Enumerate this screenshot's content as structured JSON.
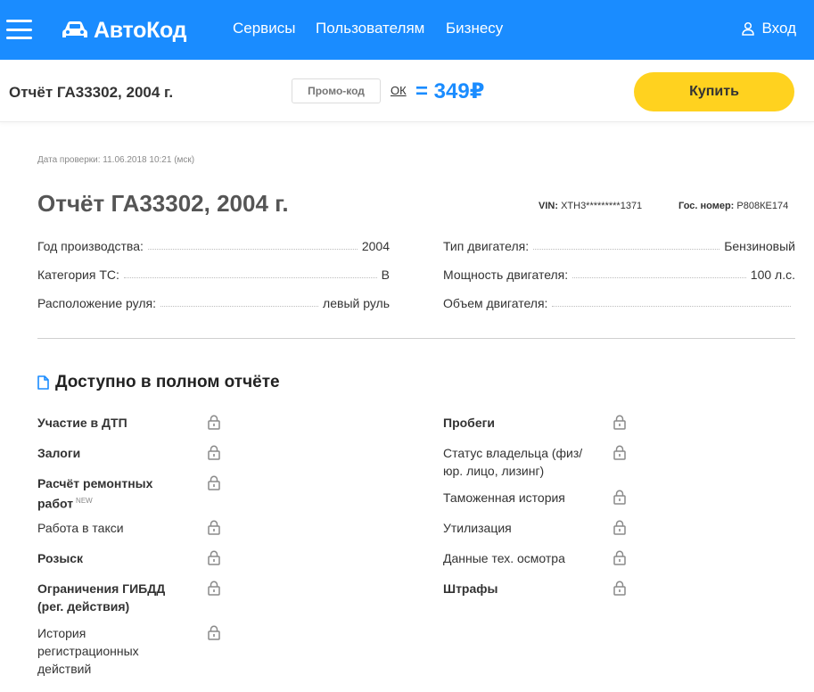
{
  "header": {
    "logo_text": "АвтоКод",
    "nav": [
      "Сервисы",
      "Пользователям",
      "Бизнесу"
    ],
    "login_label": "Вход",
    "bg_color": "#1a8cff"
  },
  "buybar": {
    "title": "Отчёт ГА33302, 2004 г.",
    "promo_placeholder": "Промо-код",
    "promo_ok": "ОК",
    "price": "= 349₽",
    "buy_label": "Купить",
    "buy_color": "#ffd21f"
  },
  "report": {
    "check_date": "Дата проверки: 11.06.2018 10:21 (мск)",
    "title": "Отчёт ГА33302, 2004 г.",
    "vin_label": "VIN:",
    "vin_value": "XTH3*********1371",
    "plate_label": "Гос. номер:",
    "plate_value": "Р808КЕ174",
    "specs_left": [
      {
        "label": "Год производства:",
        "value": "2004"
      },
      {
        "label": "Категория ТС:",
        "value": "B"
      },
      {
        "label": "Расположение руля:",
        "value": "левый руль"
      }
    ],
    "specs_right": [
      {
        "label": "Тип двигателя:",
        "value": "Бензиновый"
      },
      {
        "label": "Мощность двигателя:",
        "value": "100 л.с."
      },
      {
        "label": "Объем двигателя:",
        "value": ""
      }
    ]
  },
  "full_report": {
    "title": "Доступно в полном отчёте",
    "new_badge": "NEW",
    "left": [
      {
        "label": "Участие в ДТП",
        "bold": true
      },
      {
        "label": "Залоги",
        "bold": true
      },
      {
        "label": "Расчёт ремонтных работ",
        "bold": true,
        "new": true
      },
      {
        "label": "Работа в такси",
        "bold": false
      },
      {
        "label": "Розыск",
        "bold": true
      },
      {
        "label": "Ограничения ГИБДД (рег. действия)",
        "bold": true
      },
      {
        "label": "История регистрационных действий",
        "bold": false
      }
    ],
    "right": [
      {
        "label": "Пробеги",
        "bold": true
      },
      {
        "label": "Статус владельца (физ/ юр. лицо, лизинг)",
        "bold": false
      },
      {
        "label": "Таможенная история",
        "bold": false
      },
      {
        "label": "Утилизация",
        "bold": false
      },
      {
        "label": "Данные тех. осмотра",
        "bold": false
      },
      {
        "label": "Штрафы",
        "bold": true
      }
    ],
    "lock_icon": "lock-icon"
  }
}
